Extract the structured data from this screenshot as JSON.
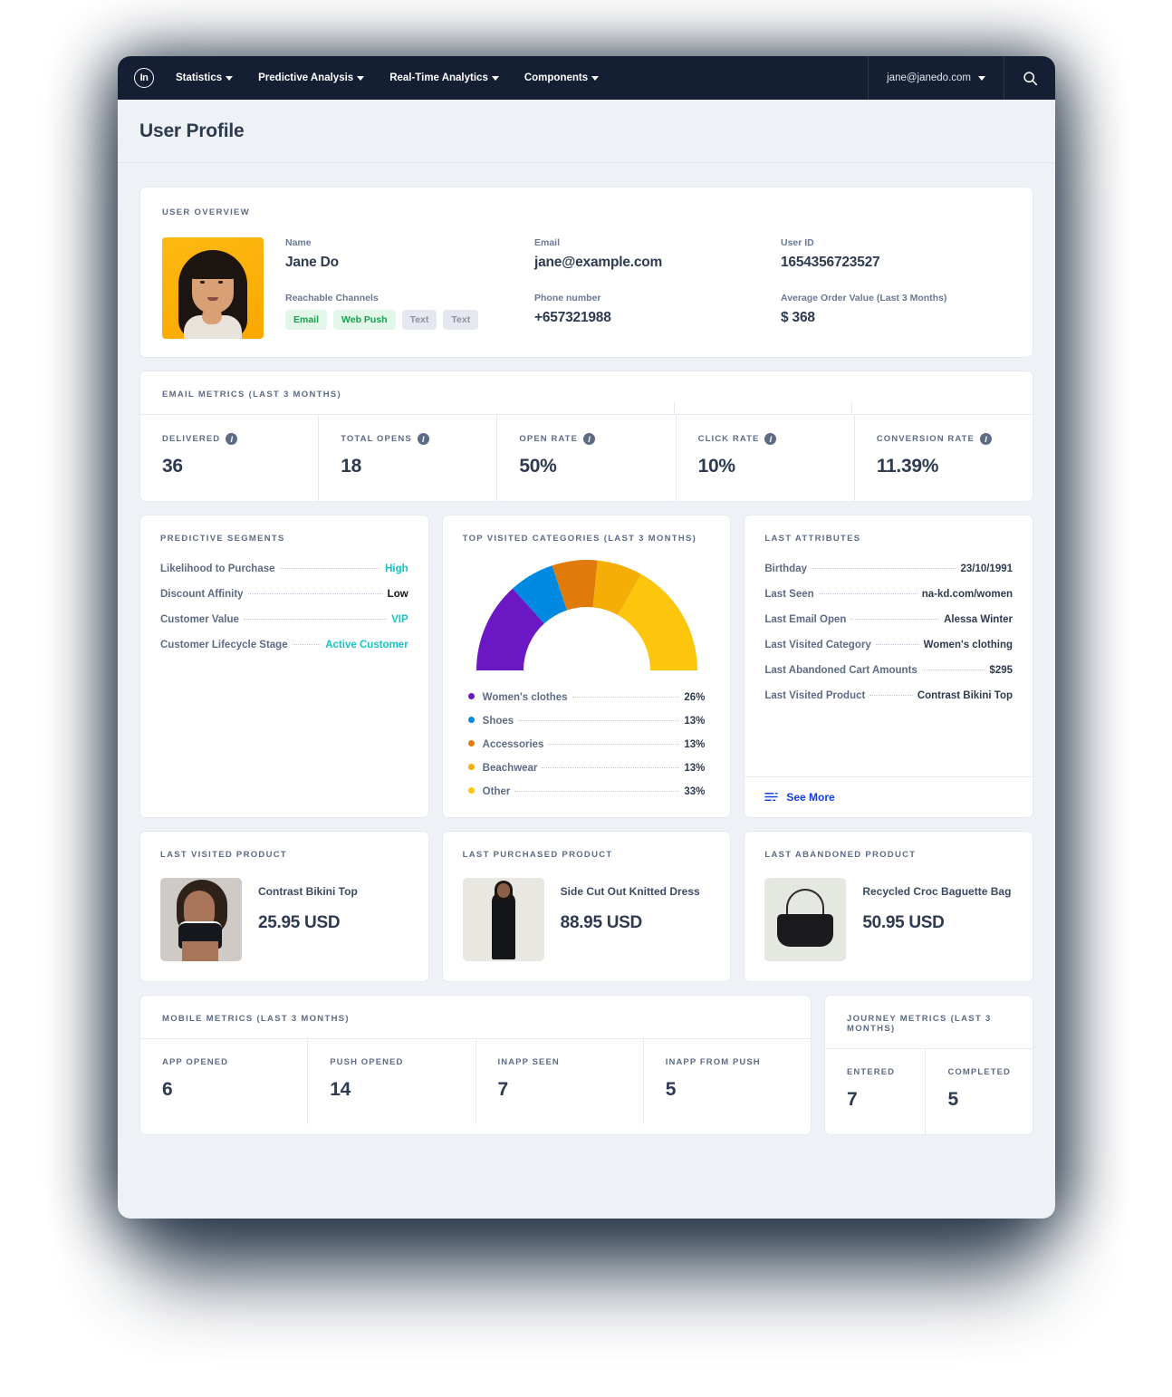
{
  "nav": {
    "logo": "In",
    "items": [
      {
        "label": "Statistics",
        "icon": "chevron-down-icon"
      },
      {
        "label": "Predictive Analysis",
        "icon": "chevron-down-icon"
      },
      {
        "label": "Real-Time Analytics",
        "icon": "chevron-down-icon"
      },
      {
        "label": "Components",
        "icon": "chevron-down-icon"
      }
    ],
    "user": "jane@janedo.com",
    "search_icon": "search-icon"
  },
  "header": {
    "title": "User Profile"
  },
  "overview": {
    "title": "USER OVERVIEW",
    "name_label": "Name",
    "name_value": "Jane Do",
    "channels_label": "Reachable Channels",
    "channels": [
      {
        "label": "Email",
        "active": true
      },
      {
        "label": "Web Push",
        "active": true
      },
      {
        "label": "Text",
        "active": false
      },
      {
        "label": "Text",
        "active": false
      }
    ],
    "email_label": "Email",
    "email_value": "jane@example.com",
    "phone_label": "Phone number",
    "phone_value": "+657321988",
    "userid_label": "User ID",
    "userid_value": "1654356723527",
    "aov_label": "Average Order Value (Last 3 Months)",
    "aov_value": "$ 368"
  },
  "email_metrics": {
    "title": "EMAIL METRICS (LAST 3 MONTHS)",
    "cells": [
      {
        "label": "DELIVERED",
        "value": "36"
      },
      {
        "label": "TOTAL OPENS",
        "value": "18"
      },
      {
        "label": "OPEN RATE",
        "value": "50%"
      },
      {
        "label": "CLICK RATE",
        "value": "10%"
      },
      {
        "label": "CONVERSION RATE",
        "value": "11.39%"
      }
    ]
  },
  "predictive_segments": {
    "title": "PREDICTIVE SEGMENTS",
    "rows": [
      {
        "label": "Likelihood to Purchase",
        "value": "High",
        "style": "teal"
      },
      {
        "label": "Discount Affinity",
        "value": "Low",
        "style": "black"
      },
      {
        "label": "Customer Value",
        "value": "VIP",
        "style": "teal"
      },
      {
        "label": "Customer Lifecycle Stage",
        "value": "Active Customer",
        "style": "teal"
      }
    ]
  },
  "top_categories": {
    "title": "TOP VISITED CATEGORIES (LAST 3 MONTHS)"
  },
  "chart_data": {
    "type": "pie",
    "title": "TOP VISITED CATEGORIES (LAST 3 MONTHS)",
    "subtype": "semicircular-donut-gauge",
    "categories": [
      "Women's clothes",
      "Shoes",
      "Accessories",
      "Beachwear",
      "Other"
    ],
    "values": [
      26,
      13,
      13,
      13,
      33
    ],
    "unit": "%",
    "colors": [
      "#6B17C4",
      "#0089E0",
      "#E07B0A",
      "#F5AD08",
      "#FDC60D"
    ],
    "legend_position": "bottom",
    "legend": [
      {
        "label": "Women's clothes",
        "value": "26%",
        "color": "#6B17C4"
      },
      {
        "label": "Shoes",
        "value": "13%",
        "color": "#0089E0"
      },
      {
        "label": "Accessories",
        "value": "13%",
        "color": "#E07B0A"
      },
      {
        "label": "Beachwear",
        "value": "13%",
        "color": "#F5AD08"
      },
      {
        "label": "Other",
        "value": "33%",
        "color": "#FDC60D"
      }
    ],
    "start_angle_deg": 180,
    "total_sweep_deg": 180,
    "grid": false
  },
  "last_attributes": {
    "title": "LAST ATTRIBUTES",
    "rows": [
      {
        "label": "Birthday",
        "value": "23/10/1991"
      },
      {
        "label": "Last Seen",
        "value": "na-kd.com/women"
      },
      {
        "label": "Last Email Open",
        "value": "Alessa Winter"
      },
      {
        "label": "Last Visited Category",
        "value": "Women's clothing"
      },
      {
        "label": "Last Abandoned Cart Amounts",
        "value": "$295"
      },
      {
        "label": "Last Visited Product",
        "value": "Contrast Bikini Top"
      }
    ],
    "see_more": "See More",
    "see_more_icon": "list-lines-icon"
  },
  "products": [
    {
      "title": "LAST VISITED PRODUCT",
      "name": "Contrast Bikini Top",
      "price": "25.95 USD",
      "image": "bikini-top-photo"
    },
    {
      "title": "LAST PURCHASED PRODUCT",
      "name": "Side Cut Out Knitted Dress",
      "price": "88.95 USD",
      "image": "knitted-dress-photo"
    },
    {
      "title": "LAST ABANDONED PRODUCT",
      "name": "Recycled Croc Baguette Bag",
      "price": "50.95 USD",
      "image": "baguette-bag-photo"
    }
  ],
  "mobile_metrics": {
    "title": "MOBILE METRICS (LAST 3 MONTHS)",
    "cells": [
      {
        "label": "APP OPENED",
        "value": "6"
      },
      {
        "label": "PUSH OPENED",
        "value": "14"
      },
      {
        "label": "INAPP SEEN",
        "value": "7"
      },
      {
        "label": "INAPP FROM PUSH",
        "value": "5"
      }
    ]
  },
  "journey_metrics": {
    "title": "JOURNEY METRICS (LAST 3 MONTHS)",
    "cells": [
      {
        "label": "ENTERED",
        "value": "7"
      },
      {
        "label": "COMPLETED",
        "value": "5"
      }
    ]
  },
  "colors": {
    "nav_bg": "#141f33",
    "page_bg": "#eef1f5",
    "accent_blue": "#1240e0",
    "accent_teal": "#17c3c3",
    "chip_green": "#11a24c",
    "text_dark": "#2e3a4f",
    "text_muted": "#5d6b85"
  }
}
